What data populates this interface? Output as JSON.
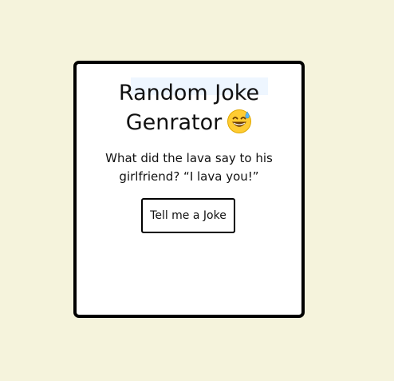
{
  "app": {
    "title_line1": "Random Joke",
    "title_line2": "Genrator",
    "emoji_icon": "grinning-face-with-sweat-icon"
  },
  "joke": {
    "text": "What did the lava say to his girlfriend? “I lava you!”"
  },
  "actions": {
    "tell_joke_label": "Tell me a Joke"
  },
  "colors": {
    "page_background": "#f5f3dc",
    "card_background": "#ffffff",
    "border": "#000000"
  }
}
